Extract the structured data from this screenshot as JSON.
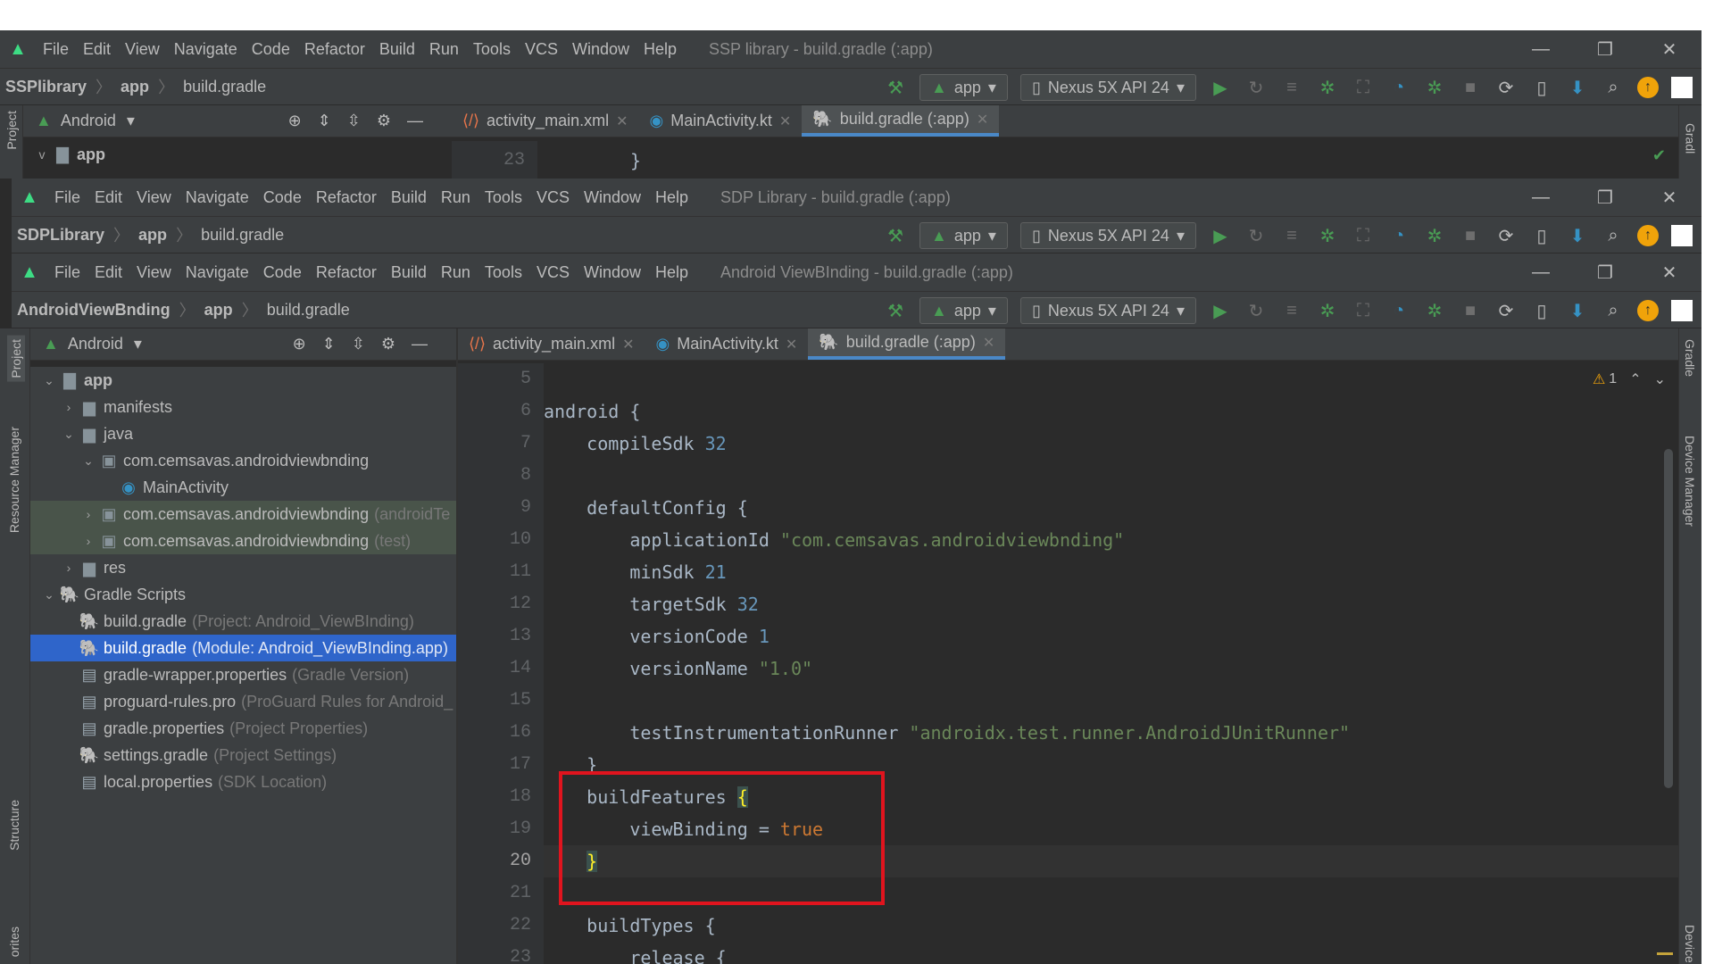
{
  "menu": [
    "File",
    "Edit",
    "View",
    "Navigate",
    "Code",
    "Refactor",
    "Build",
    "Run",
    "Tools",
    "VCS",
    "Window",
    "Help"
  ],
  "window1": {
    "title": "SSP library - build.gradle (:app)",
    "crumbs": [
      "SSPlibrary",
      "app",
      "build.gradle"
    ],
    "panel_label": "Android",
    "tree_root": "app",
    "visible_line": "23",
    "visible_code": "}"
  },
  "window2": {
    "title": "SDP Library - build.gradle (:app)",
    "crumbs": [
      "SDPLibrary",
      "app",
      "build.gradle"
    ]
  },
  "window3": {
    "title": "Android ViewBInding - build.gradle (:app)",
    "crumbs": [
      "AndroidViewBnding",
      "app",
      "build.gradle"
    ]
  },
  "toolbar": {
    "run_config": "app",
    "device": "Nexus 5X API 24"
  },
  "tabs": [
    "activity_main.xml",
    "MainActivity.kt",
    "build.gradle (:app)"
  ],
  "side_labels": {
    "project": "Project",
    "resource_manager": "Resource Manager",
    "structure": "Structure",
    "favorites": "orites",
    "gradle": "Gradle",
    "device_manager": "Device Manager",
    "device": "Device",
    "gradle_short": "Gradl"
  },
  "panel": {
    "label": "Android"
  },
  "tree": [
    {
      "name": "app",
      "hint": "",
      "level": 0,
      "arrow": "v",
      "icon": "module"
    },
    {
      "name": "manifests",
      "hint": "",
      "level": 1,
      "arrow": ">",
      "icon": "folder"
    },
    {
      "name": "java",
      "hint": "",
      "level": 1,
      "arrow": "v",
      "icon": "folder"
    },
    {
      "name": "com.cemsavas.androidviewbnding",
      "hint": "",
      "level": 2,
      "arrow": "v",
      "icon": "package"
    },
    {
      "name": "MainActivity",
      "hint": "",
      "level": 3,
      "arrow": "",
      "icon": "kotlin"
    },
    {
      "name": "com.cemsavas.androidviewbnding",
      "hint": "(androidTe",
      "level": 2,
      "arrow": ">",
      "icon": "package"
    },
    {
      "name": "com.cemsavas.androidviewbnding",
      "hint": "(test)",
      "level": 2,
      "arrow": ">",
      "icon": "package"
    },
    {
      "name": "res",
      "hint": "",
      "level": 1,
      "arrow": ">",
      "icon": "folder"
    },
    {
      "name": "Gradle Scripts",
      "hint": "",
      "level": 0,
      "arrow": "v",
      "icon": "gradle"
    },
    {
      "name": "build.gradle",
      "hint": "(Project: Android_ViewBInding)",
      "level": 1,
      "arrow": "",
      "icon": "gradle"
    },
    {
      "name": "build.gradle",
      "hint": "(Module: Android_ViewBInding.app)",
      "level": 1,
      "arrow": "",
      "icon": "gradle"
    },
    {
      "name": "gradle-wrapper.properties",
      "hint": "(Gradle Version)",
      "level": 1,
      "arrow": "",
      "icon": "props"
    },
    {
      "name": "proguard-rules.pro",
      "hint": "(ProGuard Rules for Android_",
      "level": 1,
      "arrow": "",
      "icon": "props"
    },
    {
      "name": "gradle.properties",
      "hint": "(Project Properties)",
      "level": 1,
      "arrow": "",
      "icon": "props"
    },
    {
      "name": "settings.gradle",
      "hint": "(Project Settings)",
      "level": 1,
      "arrow": "",
      "icon": "gradle"
    },
    {
      "name": "local.properties",
      "hint": "(SDK Location)",
      "level": 1,
      "arrow": "",
      "icon": "props"
    }
  ],
  "editor": {
    "warning_count": "1",
    "line_numbers": [
      "5",
      "6",
      "7",
      "8",
      "9",
      "10",
      "11",
      "12",
      "13",
      "14",
      "15",
      "16",
      "17",
      "18",
      "19",
      "20",
      "21",
      "22",
      "23"
    ],
    "current_line": "20",
    "lines": [
      "",
      "android {",
      "    compileSdk 32",
      "",
      "    defaultConfig {",
      "        applicationId \"com.cemsavas.androidviewbnding\"",
      "        minSdk 21",
      "        targetSdk 32",
      "        versionCode 1",
      "        versionName \"1.0\"",
      "",
      "        testInstrumentationRunner \"androidx.test.runner.AndroidJUnitRunner\"",
      "    }",
      "    buildFeatures {",
      "        viewBinding = true",
      "    }",
      "",
      "    buildTypes {",
      "        release {"
    ]
  },
  "colors": {
    "highlight_box": "#e0141e",
    "selection": "#2f65ca",
    "keyword": "#cc7832",
    "number": "#6897bb",
    "string": "#6a8759"
  }
}
